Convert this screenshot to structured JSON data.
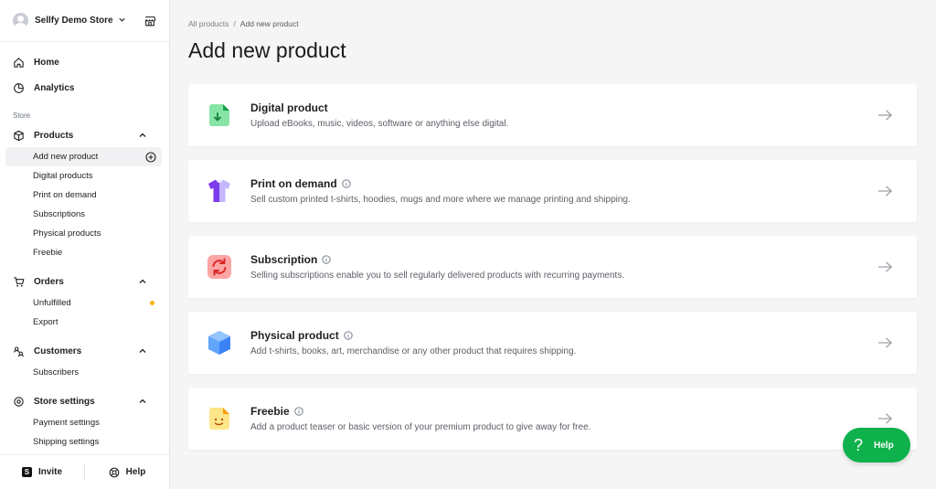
{
  "store": {
    "name": "Sellfy Demo Store"
  },
  "nav": {
    "home": "Home",
    "analytics": "Analytics",
    "store_section": "Store"
  },
  "groups": {
    "products": {
      "label": "Products",
      "items": [
        "Add new product",
        "Digital products",
        "Print on demand",
        "Subscriptions",
        "Physical products",
        "Freebie"
      ]
    },
    "orders": {
      "label": "Orders",
      "items": [
        "Unfulfilled",
        "Export"
      ]
    },
    "customers": {
      "label": "Customers",
      "items": [
        "Subscribers"
      ]
    },
    "settings": {
      "label": "Store settings",
      "items": [
        "Payment settings",
        "Shipping settings"
      ]
    }
  },
  "footer": {
    "invite": "Invite",
    "help": "Help"
  },
  "breadcrumb": {
    "root": "All products",
    "separator": "/",
    "current": "Add new product"
  },
  "page": {
    "title": "Add new product"
  },
  "cards": [
    {
      "title": "Digital product",
      "desc": "Upload eBooks, music, videos, software or anything else digital.",
      "icon": "digital-file-icon",
      "color": "#22c55e"
    },
    {
      "title": "Print on demand",
      "desc": "Sell custom printed t-shirts, hoodies, mugs and more where we manage printing and shipping.",
      "icon": "tshirt-icon",
      "color": "#8b5cf6"
    },
    {
      "title": "Subscription",
      "desc": "Selling subscriptions enable you to sell regularly delivered products with recurring payments.",
      "icon": "recurring-icon",
      "color": "#ef4444"
    },
    {
      "title": "Physical product",
      "desc": "Add t-shirts, books, art, merchandise or any other product that requires shipping.",
      "icon": "box-icon",
      "color": "#3b82f6"
    },
    {
      "title": "Freebie",
      "desc": "Add a product teaser or basic version of your premium product to give away for free.",
      "icon": "smile-icon",
      "color": "#fbbf24"
    }
  ],
  "help_fab": {
    "symbol": "?",
    "label": "Help",
    "color": "#0eb14b"
  },
  "footer_logo": "S"
}
